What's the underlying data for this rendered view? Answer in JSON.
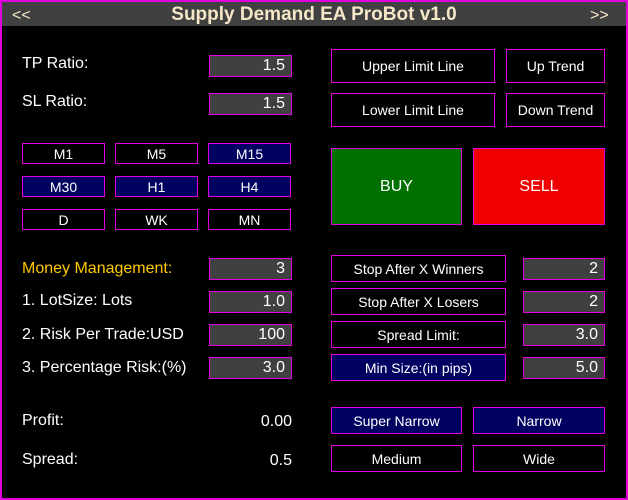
{
  "title": "Supply Demand EA ProBot v1.0",
  "nav": {
    "prev": "<<",
    "next": ">>"
  },
  "tp": {
    "label": "TP Ratio:",
    "value": "1.5"
  },
  "sl": {
    "label": "SL Ratio:",
    "value": "1.5"
  },
  "timeframes": [
    {
      "label": "M1",
      "selected": false
    },
    {
      "label": "M5",
      "selected": false
    },
    {
      "label": "M15",
      "selected": true
    },
    {
      "label": "M30",
      "selected": true
    },
    {
      "label": "H1",
      "selected": true
    },
    {
      "label": "H4",
      "selected": true
    },
    {
      "label": "D",
      "selected": false
    },
    {
      "label": "WK",
      "selected": false
    },
    {
      "label": "MN",
      "selected": false
    }
  ],
  "lines": {
    "upper": "Upper Limit Line",
    "lower": "Lower Limit Line",
    "up": "Up Trend",
    "down": "Down Trend"
  },
  "trade": {
    "buy": "BUY",
    "sell": "SELL",
    "buy_color": "#007000",
    "sell_color": "#f00000"
  },
  "mm": {
    "label": "Money Management:",
    "value": "3",
    "lot_label": "1. LotSize: Lots",
    "lot": "1.0",
    "risk_label": "2. Risk Per Trade:USD",
    "risk": "100",
    "pct_label": "3. Percentage Risk:(%)",
    "pct": "3.0"
  },
  "limits": {
    "winners": "Stop After X Winners",
    "winners_val": "2",
    "losers": "Stop After X Losers",
    "losers_val": "2",
    "spread": "Spread Limit:",
    "spread_val": "3.0",
    "minsize": "Min Size:(in pips)",
    "minsize_val": "5.0"
  },
  "stats": {
    "profit_label": "Profit:",
    "profit": "0.00",
    "spread_label": "Spread:",
    "spread": "0.5"
  },
  "widths": {
    "super_narrow": "Super Narrow",
    "narrow": "Narrow",
    "medium": "Medium",
    "wide": "Wide"
  }
}
